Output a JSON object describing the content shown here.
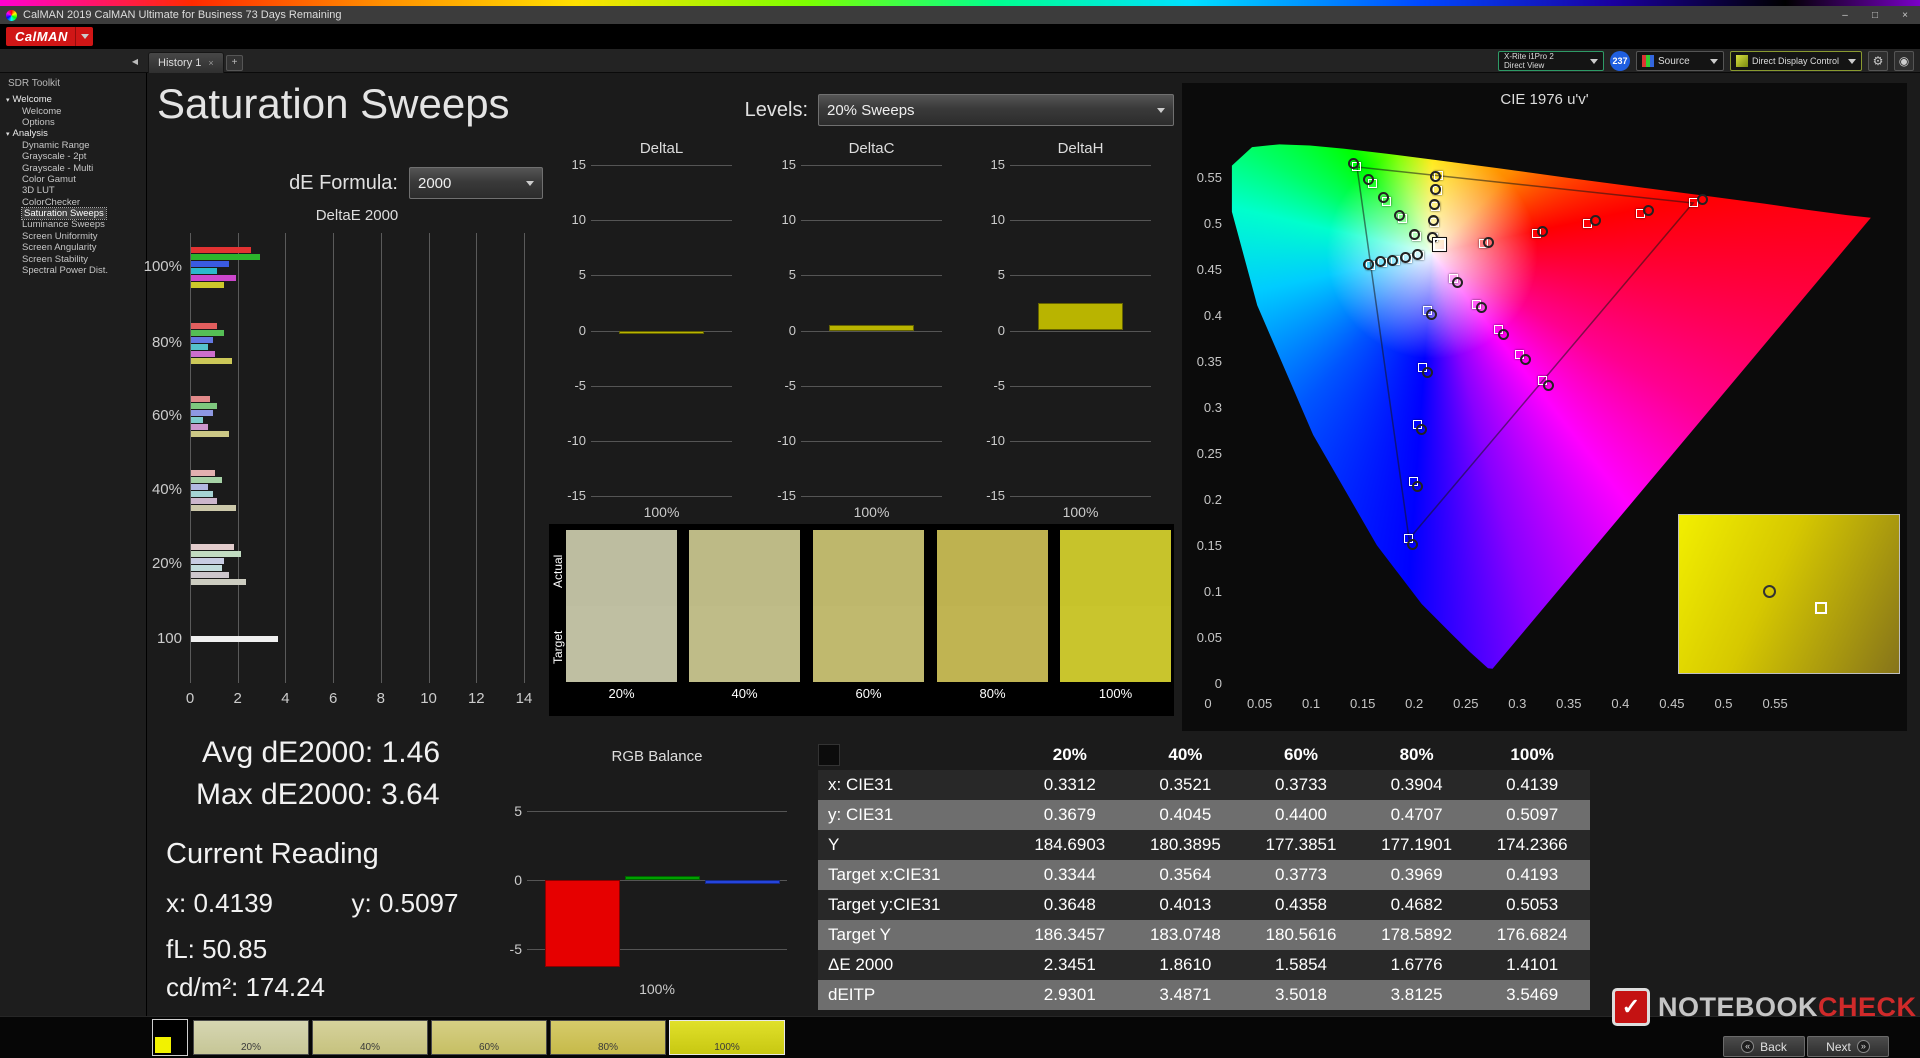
{
  "titlebar": {
    "title": "CalMAN 2019 CalMAN Ultimate for Business 73 Days Remaining"
  },
  "window_controls": {
    "minimize": "–",
    "maximize": "□",
    "close": "×"
  },
  "menubar": {
    "logo": "CalMAN"
  },
  "tabbar": {
    "collapse_icon": "◀",
    "tab_label": "History 1",
    "tab_close_icon": "×",
    "add_icon": "+",
    "meter_line1": "X-Rite i1Pro 2",
    "meter_line2": "Direct View",
    "meter_badge": "237",
    "source_label": "Source",
    "ddc_label": "Direct Display Control",
    "gear_icon": "⚙",
    "probe_icon": "◉"
  },
  "sidebar": {
    "header": "SDR Toolkit",
    "expand_icon": "▾",
    "items": [
      {
        "label": "Welcome",
        "level": 0,
        "parent": true
      },
      {
        "label": "Welcome",
        "level": 1
      },
      {
        "label": "Options",
        "level": 1
      },
      {
        "label": "Analysis",
        "level": 0,
        "parent": true
      },
      {
        "label": "Dynamic Range",
        "level": 1
      },
      {
        "label": "Grayscale - 2pt",
        "level": 1
      },
      {
        "label": "Grayscale - Multi",
        "level": 1
      },
      {
        "label": "Color Gamut",
        "level": 1
      },
      {
        "label": "3D LUT",
        "level": 1
      },
      {
        "label": "ColorChecker",
        "level": 1
      },
      {
        "label": "Saturation Sweeps",
        "level": 1,
        "selected": true
      },
      {
        "label": "Luminance Sweeps",
        "level": 1
      },
      {
        "label": "Screen Uniformity",
        "level": 1
      },
      {
        "label": "Screen Angularity",
        "level": 1
      },
      {
        "label": "Screen Stability",
        "level": 1
      },
      {
        "label": "Spectral Power Dist.",
        "level": 1
      }
    ]
  },
  "page": {
    "title": "Saturation Sweeps",
    "levels_label": "Levels:",
    "levels_value": "20% Sweeps",
    "de_formula_label": "dE Formula:",
    "de_formula_value": "2000"
  },
  "readings": {
    "avg_label": "Avg dE2000:",
    "avg_value": "1.46",
    "max_label": "Max dE2000:",
    "max_value": "3.64",
    "current_heading": "Current Reading",
    "x_label": "x:",
    "x_value": "0.4139",
    "y_label": "y:",
    "y_value": "0.5097",
    "fl_label": "fL:",
    "fl_value": "50.85",
    "cdm2_label": "cd/m²:",
    "cdm2_value": "174.24"
  },
  "swatch_panel": {
    "row_labels": {
      "actual": "Actual",
      "target": "Target"
    },
    "swatches": [
      {
        "label": "20%",
        "actual": "#bdbda0",
        "target": "#bfbfa2"
      },
      {
        "label": "40%",
        "actual": "#bdba86",
        "target": "#bfbc88"
      },
      {
        "label": "60%",
        "actual": "#beb76c",
        "target": "#c0b96e"
      },
      {
        "label": "80%",
        "actual": "#beb250",
        "target": "#c0b452"
      },
      {
        "label": "100%",
        "actual": "#c7c32b",
        "target": "#c9c52d"
      }
    ]
  },
  "table": {
    "headers": [
      "20%",
      "40%",
      "60%",
      "80%",
      "100%"
    ],
    "rows": [
      {
        "label": "x: CIE31",
        "values": [
          "0.3312",
          "0.3521",
          "0.3733",
          "0.3904",
          "0.4139"
        ]
      },
      {
        "label": "y: CIE31",
        "values": [
          "0.3679",
          "0.4045",
          "0.4400",
          "0.4707",
          "0.5097"
        ]
      },
      {
        "label": "Y",
        "values": [
          "184.6903",
          "180.3895",
          "177.3851",
          "177.1901",
          "174.2366"
        ]
      },
      {
        "label": "Target x:CIE31",
        "values": [
          "0.3344",
          "0.3564",
          "0.3773",
          "0.3969",
          "0.4193"
        ]
      },
      {
        "label": "Target y:CIE31",
        "values": [
          "0.3648",
          "0.4013",
          "0.4358",
          "0.4682",
          "0.5053"
        ]
      },
      {
        "label": "Target Y",
        "values": [
          "186.3457",
          "183.0748",
          "180.5616",
          "178.5892",
          "176.6824"
        ]
      },
      {
        "label": "ΔE 2000",
        "values": [
          "2.3451",
          "1.8610",
          "1.5854",
          "1.6776",
          "1.4101"
        ]
      },
      {
        "label": "dEITP",
        "values": [
          "2.9301",
          "3.4871",
          "3.5018",
          "3.8125",
          "3.5469"
        ]
      }
    ]
  },
  "bottombar": {
    "patch_color": "#f2f200",
    "thumbs": [
      {
        "label": "20%",
        "from": "#d6d6b2",
        "to": "#c6c696"
      },
      {
        "label": "40%",
        "from": "#d6d29c",
        "to": "#c6c27e"
      },
      {
        "label": "60%",
        "from": "#d6cf84",
        "to": "#c6bf64"
      },
      {
        "label": "80%",
        "from": "#d6cb6a",
        "to": "#c6ba4a"
      },
      {
        "label": "100%",
        "from": "#e0e02a",
        "to": "#c8c812",
        "selected": true
      }
    ],
    "back_label": "Back",
    "next_label": "Next",
    "back_icon": "«",
    "next_icon": "»"
  },
  "watermark": {
    "logo_glyph": "✓",
    "part1": "NOTEBOOK",
    "part2": "CHECK"
  },
  "chart_data": [
    {
      "name": "deltaE",
      "type": "bar",
      "orientation": "horizontal",
      "title": "DeltaE 2000",
      "xlim": [
        0,
        14
      ],
      "x_ticks": [
        0,
        2,
        4,
        6,
        8,
        10,
        12,
        14
      ],
      "groups": [
        {
          "label": "100%",
          "series": [
            "red",
            "green",
            "blue",
            "cyan",
            "magenta",
            "yellow"
          ],
          "values": [
            2.5,
            2.9,
            1.6,
            1.1,
            1.9,
            1.4
          ],
          "colors": [
            "#e23232",
            "#2cb42c",
            "#3a5ae2",
            "#2cb8cc",
            "#cc46cc",
            "#ccc82a"
          ]
        },
        {
          "label": "80%",
          "series": [
            "red",
            "green",
            "blue",
            "cyan",
            "magenta",
            "yellow"
          ],
          "values": [
            1.1,
            1.4,
            0.9,
            0.7,
            1.0,
            1.7
          ],
          "colors": [
            "#e25e5e",
            "#55be55",
            "#6478e2",
            "#55c2cc",
            "#cc6ecc",
            "#ccc858"
          ]
        },
        {
          "label": "60%",
          "series": [
            "red",
            "green",
            "blue",
            "cyan",
            "magenta",
            "yellow"
          ],
          "values": [
            0.8,
            1.1,
            0.9,
            0.5,
            0.7,
            1.6
          ],
          "colors": [
            "#e28a8a",
            "#7ec87e",
            "#8e98e2",
            "#7ecccc",
            "#cc96cc",
            "#ccc886"
          ]
        },
        {
          "label": "40%",
          "series": [
            "red",
            "green",
            "blue",
            "cyan",
            "magenta",
            "yellow"
          ],
          "values": [
            1.0,
            1.3,
            0.7,
            0.9,
            1.1,
            1.9
          ],
          "colors": [
            "#e2b0b0",
            "#a6d2a6",
            "#b2b8e2",
            "#a6d4d4",
            "#ccb6cc",
            "#ccc8aa"
          ]
        },
        {
          "label": "20%",
          "series": [
            "red",
            "green",
            "blue",
            "cyan",
            "magenta",
            "yellow"
          ],
          "values": [
            1.8,
            2.1,
            1.4,
            1.3,
            1.6,
            2.3
          ],
          "colors": [
            "#e2cccc",
            "#c2dcc2",
            "#c8cce2",
            "#c2dcdc",
            "#ccc6cc",
            "#ccccc0"
          ]
        },
        {
          "label": "100",
          "series": [
            "white"
          ],
          "values": [
            3.64
          ],
          "colors": [
            "#f0f0f0"
          ]
        }
      ]
    },
    {
      "name": "deltaL",
      "type": "bar",
      "title": "DeltaL",
      "ylim": [
        -15,
        15
      ],
      "y_ticks": [
        15,
        10,
        5,
        0,
        -5,
        -10,
        -15
      ],
      "categories": [
        "100%"
      ],
      "values": [
        -0.3
      ],
      "color": "#b9b400"
    },
    {
      "name": "deltaC",
      "type": "bar",
      "title": "DeltaC",
      "ylim": [
        -15,
        15
      ],
      "y_ticks": [
        15,
        10,
        5,
        0,
        -5,
        -10,
        -15
      ],
      "categories": [
        "100%"
      ],
      "values": [
        0.5
      ],
      "color": "#b9b400"
    },
    {
      "name": "deltaH",
      "type": "bar",
      "title": "DeltaH",
      "ylim": [
        -15,
        15
      ],
      "y_ticks": [
        15,
        10,
        5,
        0,
        -5,
        -10,
        -15
      ],
      "categories": [
        "100%"
      ],
      "values": [
        2.5
      ],
      "color": "#b9b400"
    },
    {
      "name": "cie",
      "type": "scatter",
      "title": "CIE 1976 u'v'",
      "xlim": [
        0,
        0.63
      ],
      "ylim": [
        0,
        0.59
      ],
      "x_ticks": [
        0,
        0.05,
        0.1,
        0.15,
        0.2,
        0.25,
        0.3,
        0.35,
        0.4,
        0.45,
        0.5,
        0.55
      ],
      "y_ticks": [
        0,
        0.05,
        0.1,
        0.15,
        0.2,
        0.25,
        0.3,
        0.35,
        0.4,
        0.45,
        0.5,
        0.55
      ],
      "white_point": [
        0.1978,
        0.4683
      ],
      "gamut_triangle": [
        [
          0.4507,
          0.5229
        ],
        [
          0.125,
          0.5625
        ],
        [
          0.1754,
          0.1579
        ]
      ],
      "targets": [
        [
          0.248,
          0.479
        ],
        [
          0.299,
          0.49
        ],
        [
          0.349,
          0.501
        ],
        [
          0.4,
          0.512
        ],
        [
          0.451,
          0.523
        ],
        [
          0.183,
          0.487
        ],
        [
          0.169,
          0.506
        ],
        [
          0.154,
          0.525
        ],
        [
          0.14,
          0.544
        ],
        [
          0.125,
          0.563
        ],
        [
          0.193,
          0.406
        ],
        [
          0.189,
          0.344
        ],
        [
          0.184,
          0.282
        ],
        [
          0.18,
          0.22
        ],
        [
          0.175,
          0.158
        ],
        [
          0.199,
          0.485
        ],
        [
          0.2,
          0.502
        ],
        [
          0.201,
          0.519
        ],
        [
          0.203,
          0.536
        ],
        [
          0.204,
          0.553
        ],
        [
          0.219,
          0.441
        ],
        [
          0.241,
          0.413
        ],
        [
          0.262,
          0.385
        ],
        [
          0.283,
          0.358
        ],
        [
          0.305,
          0.33
        ],
        [
          0.186,
          0.466
        ],
        [
          0.174,
          0.463
        ],
        [
          0.162,
          0.46
        ],
        [
          0.15,
          0.458
        ],
        [
          0.138,
          0.455
        ]
      ],
      "measured": [
        [
          0.252,
          0.481
        ],
        [
          0.304,
          0.493
        ],
        [
          0.355,
          0.505
        ],
        [
          0.407,
          0.516
        ],
        [
          0.459,
          0.528
        ],
        [
          0.18,
          0.49
        ],
        [
          0.165,
          0.51
        ],
        [
          0.15,
          0.53
        ],
        [
          0.135,
          0.549
        ],
        [
          0.121,
          0.567
        ],
        [
          0.196,
          0.403
        ],
        [
          0.192,
          0.34
        ],
        [
          0.187,
          0.278
        ],
        [
          0.183,
          0.216
        ],
        [
          0.178,
          0.153
        ],
        [
          0.197,
          0.487
        ],
        [
          0.198,
          0.505
        ],
        [
          0.199,
          0.522
        ],
        [
          0.2,
          0.539
        ],
        [
          0.2,
          0.553
        ],
        [
          0.222,
          0.438
        ],
        [
          0.245,
          0.41
        ],
        [
          0.266,
          0.381
        ],
        [
          0.288,
          0.354
        ],
        [
          0.31,
          0.326
        ],
        [
          0.183,
          0.468
        ],
        [
          0.171,
          0.465
        ],
        [
          0.159,
          0.462
        ],
        [
          0.147,
          0.46
        ],
        [
          0.135,
          0.457
        ]
      ],
      "current": [
        0.205,
        0.478
      ]
    },
    {
      "name": "rgb_balance",
      "type": "bar",
      "title": "RGB Balance",
      "ylim": [
        -7,
        7
      ],
      "y_ticks": [
        5,
        0,
        -5
      ],
      "categories": [
        "Red",
        "Green",
        "Blue"
      ],
      "values": [
        -6.3,
        0.3,
        -0.3
      ],
      "colors": [
        "#e60000",
        "#00a000",
        "#2545dd"
      ],
      "x_tick": "100%"
    }
  ]
}
